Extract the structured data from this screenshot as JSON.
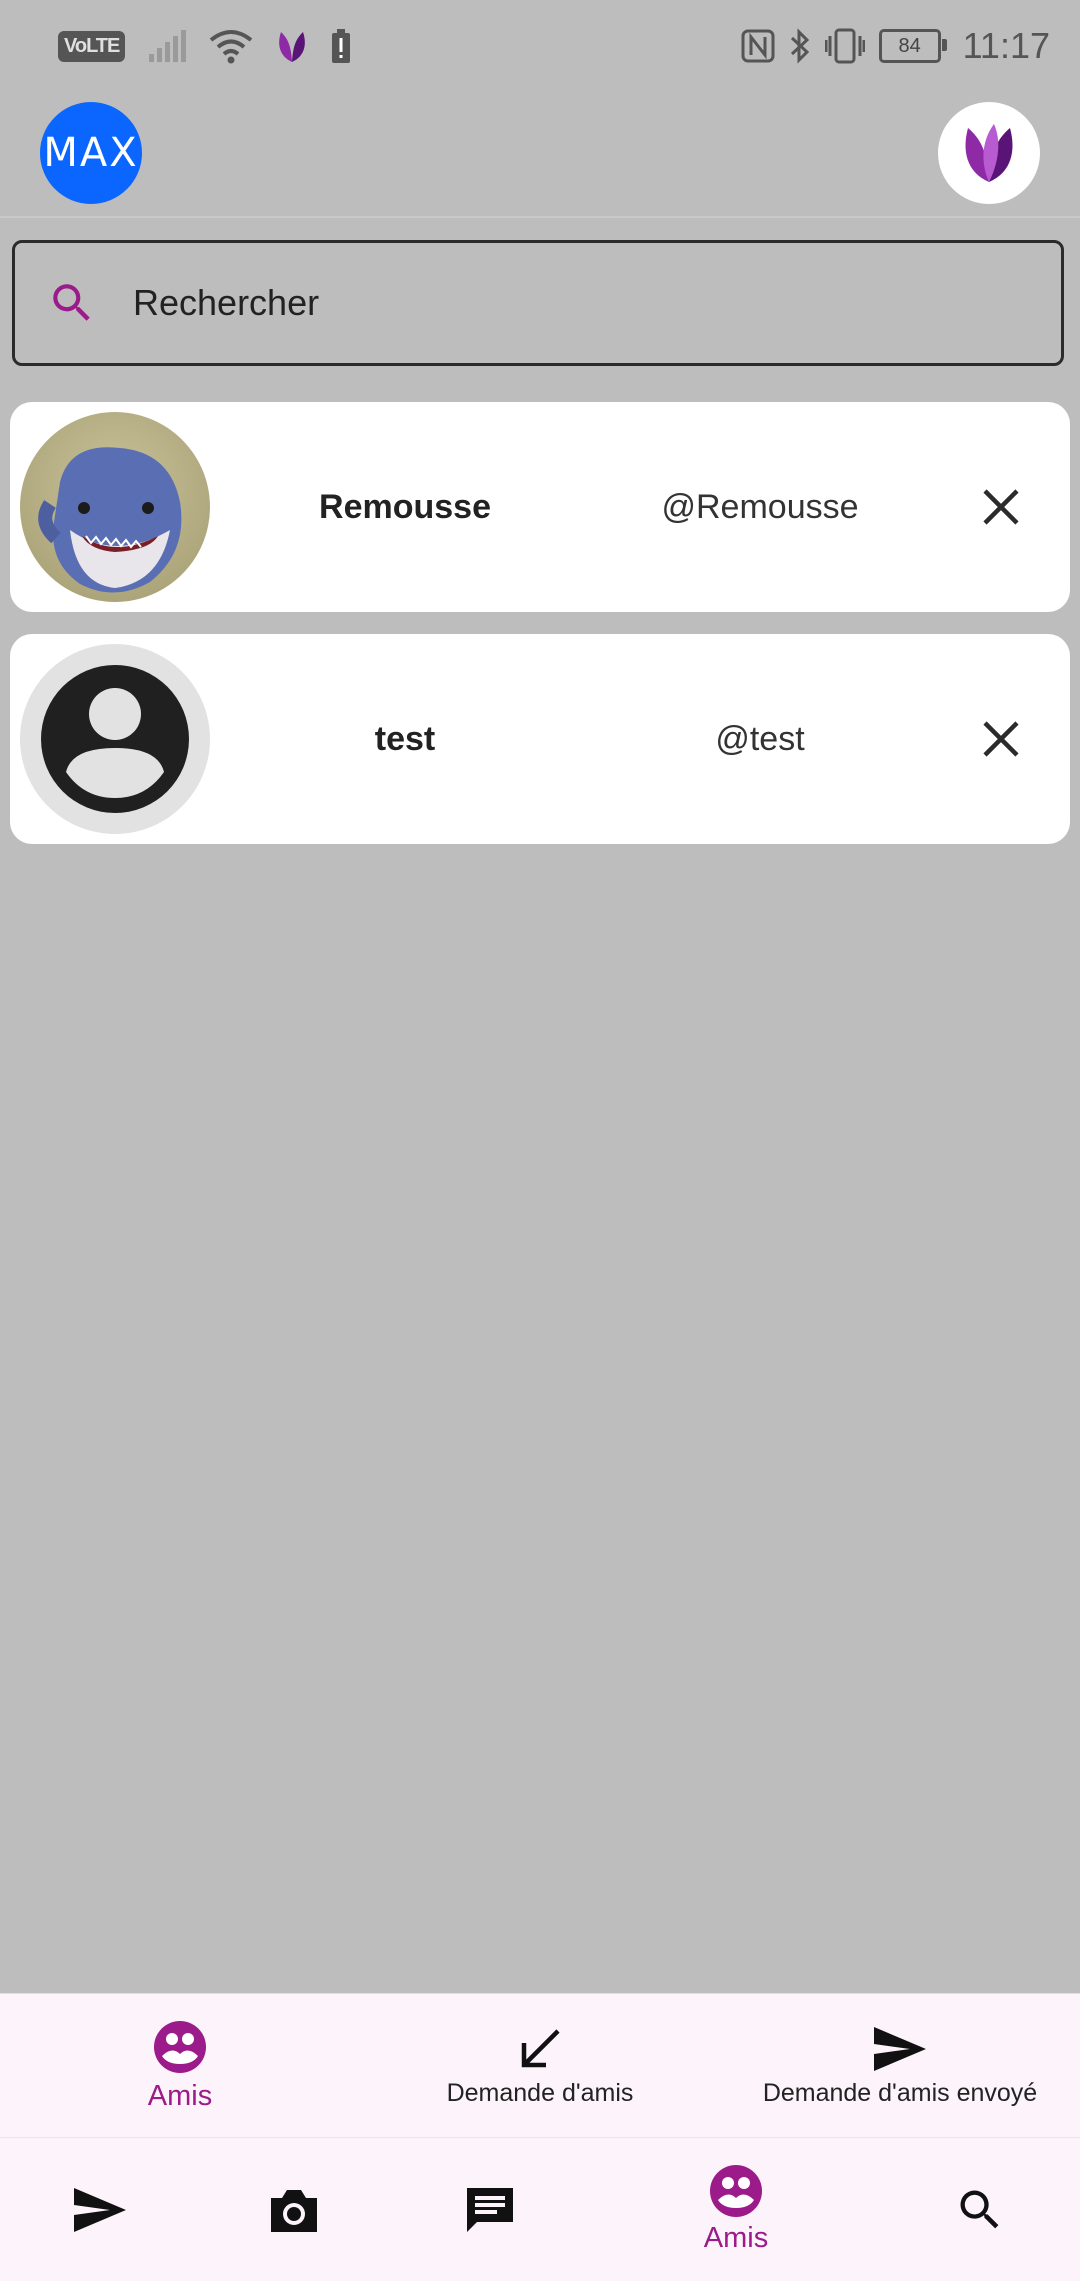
{
  "status_bar": {
    "network_badge": "VoLTE",
    "battery_level": "84",
    "time": "11:17",
    "icons": [
      "signal-icon",
      "wifi-icon",
      "app-notification-icon",
      "battery-alert-icon",
      "nfc-icon",
      "bluetooth-icon",
      "vibrate-icon",
      "battery-icon"
    ]
  },
  "header": {
    "profile_logo_text": "MAX",
    "app_logo": "lotus-logo-icon"
  },
  "search": {
    "placeholder": "Rechercher"
  },
  "friends": [
    {
      "name": "Remousse",
      "handle": "@Remousse",
      "avatar": "shark-photo"
    },
    {
      "name": "test",
      "handle": "@test",
      "avatar": "default-person-icon"
    }
  ],
  "tabs": [
    {
      "label": "Amis",
      "icon": "friends-icon",
      "active": true
    },
    {
      "label": "Demande d'amis",
      "icon": "arrow-down-left-icon",
      "active": false
    },
    {
      "label": "Demande d'amis envoyé",
      "icon": "send-icon",
      "active": false
    }
  ],
  "bottom_nav": [
    {
      "label": "",
      "icon": "send-icon"
    },
    {
      "label": "",
      "icon": "camera-icon"
    },
    {
      "label": "",
      "icon": "chat-icon"
    },
    {
      "label": "Amis",
      "icon": "friends-icon",
      "active": true
    },
    {
      "label": "",
      "icon": "search-icon"
    }
  ],
  "colors": {
    "accent": "#9c1b8a",
    "background": "#bdbdbd",
    "nav_background": "#fdf4fb",
    "logo_blue": "#0a66ff"
  }
}
